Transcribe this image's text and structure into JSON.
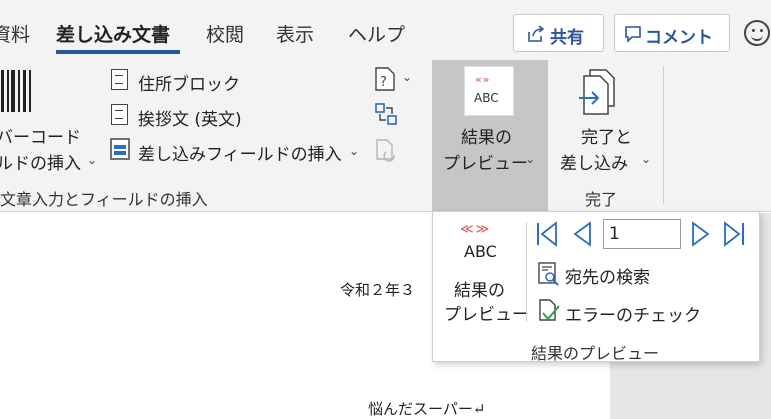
{
  "tabs": {
    "partial_left": "資料",
    "active": "差し込み文書",
    "review": "校閲",
    "view": "表示",
    "help": "ヘルプ"
  },
  "top_buttons": {
    "share": "共有",
    "comments": "コメント"
  },
  "ribbon": {
    "barcode_line1": "バーコード",
    "barcode_line2": "ルドの挿入",
    "address_block": "住所ブロック",
    "greeting_line": "挨拶文 (英文)",
    "insert_merge_field": "差し込みフィールドの挿入",
    "group_write_insert": "文章入力とフィールドの挿入",
    "preview_icon_text": "ABC",
    "preview_line1": "結果の",
    "preview_line2": "プレビュー",
    "finish_line1": "完了と",
    "finish_line2": "差し込み",
    "group_finish": "完了"
  },
  "panel": {
    "icon_text": "ABC",
    "preview_line1": "結果の",
    "preview_line2": "プレビュー",
    "record_value": "1",
    "find_recipient": "宛先の検索",
    "check_errors": "エラーのチェック",
    "group_label": "結果のプレビュー"
  },
  "document": {
    "date_fragment": "令和２年３",
    "store_line": "悩んだスーパー↵"
  },
  "colors": {
    "accent": "#2b579a",
    "preview_arrows": "#d9534f",
    "nav_blue": "#2b6cc4",
    "active_group_bg": "#c6c6c6"
  }
}
